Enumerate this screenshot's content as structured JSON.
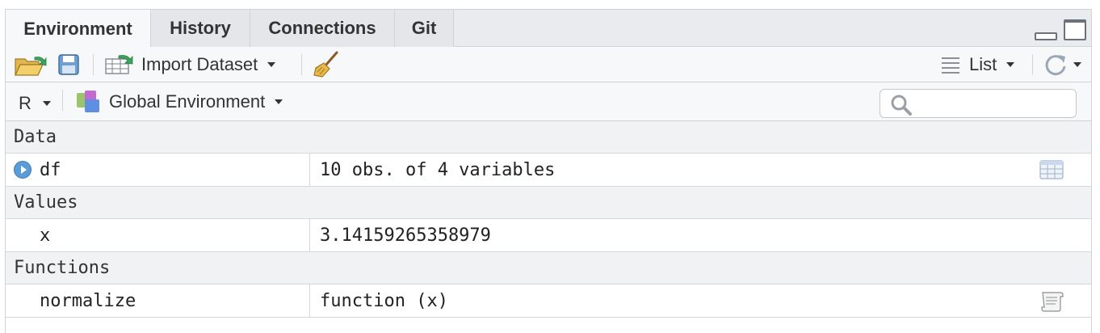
{
  "tabs": [
    {
      "label": "Environment",
      "active": true
    },
    {
      "label": "History",
      "active": false
    },
    {
      "label": "Connections",
      "active": false
    },
    {
      "label": "Git",
      "active": false
    }
  ],
  "toolbar": {
    "import_dataset_label": "Import Dataset",
    "view_mode_label": "List"
  },
  "scope_bar": {
    "language_label": "R",
    "environment_label": "Global Environment",
    "search_placeholder": ""
  },
  "sections": {
    "data": {
      "title": "Data",
      "rows": [
        {
          "name": "df",
          "value": "10 obs. of 4 variables"
        }
      ]
    },
    "values": {
      "title": "Values",
      "rows": [
        {
          "name": "x",
          "value": "3.14159265358979"
        }
      ]
    },
    "functions": {
      "title": "Functions",
      "rows": [
        {
          "name": "normalize",
          "value": "function (x)"
        }
      ]
    }
  },
  "icons": {
    "open": "open-folder-icon",
    "save": "save-icon",
    "import": "import-dataset-icon",
    "clear": "broom-icon",
    "list": "list-view-icon",
    "refresh": "refresh-icon",
    "environment": "environment-icon",
    "search": "search-icon",
    "view_data": "table-grid-icon",
    "view_function": "script-icon"
  },
  "colors": {
    "accent": "#5b9bd6",
    "tab_bg": "#e4e6e9",
    "toolbar_bg": "#f7f8f9",
    "section_bg": "#f1f2f4"
  }
}
